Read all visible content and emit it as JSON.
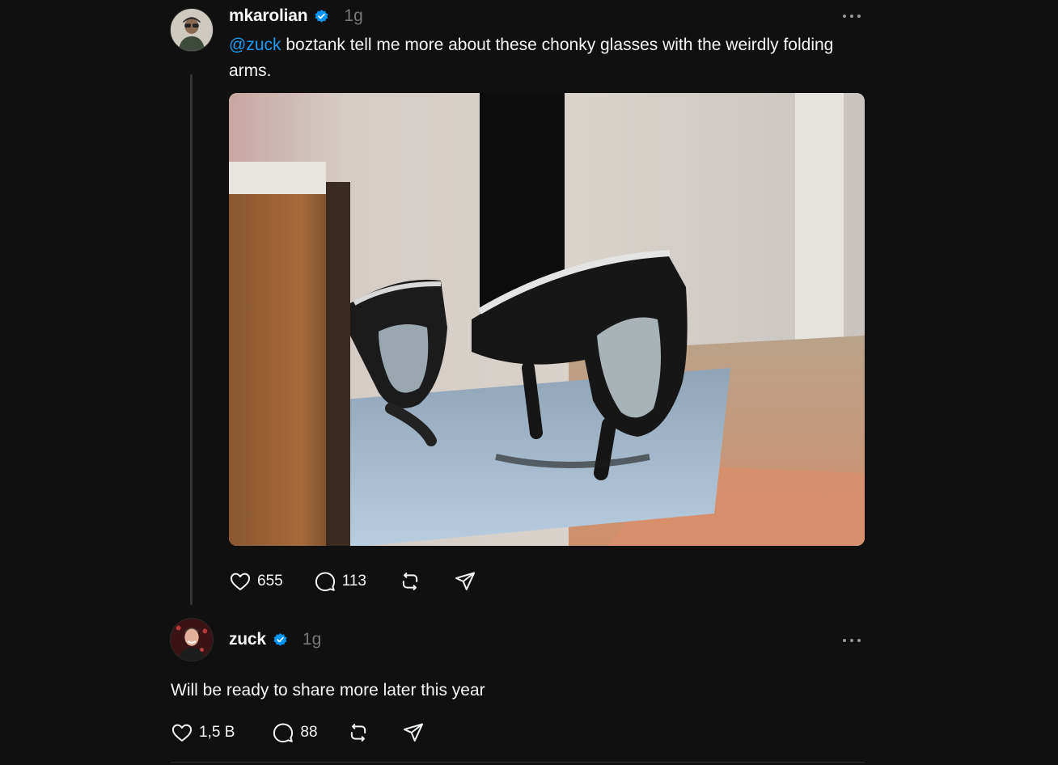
{
  "posts": [
    {
      "username": "mkarolian",
      "verified": true,
      "time": "1g",
      "mention": "@zuck",
      "text": " boztank tell me more about these chonky glasses with the weirdly folding arms.",
      "has_image": true,
      "image_icon": "photo-of-glasses",
      "likes": "655",
      "replies": "113"
    },
    {
      "username": "zuck",
      "verified": true,
      "time": "1g",
      "text": "Will be ready to share more later this year",
      "likes": "1,5 B",
      "replies": "88"
    }
  ],
  "icons": {
    "verified": "verified-badge-icon",
    "more": "more-options-icon",
    "like": "heart-icon",
    "reply": "comment-icon",
    "repost": "repost-icon",
    "share": "send-icon"
  },
  "colors": {
    "background": "#101010",
    "text": "#f3f5f7",
    "muted": "#777777",
    "mention": "#1d9bf0",
    "verified": "#0095f6"
  }
}
